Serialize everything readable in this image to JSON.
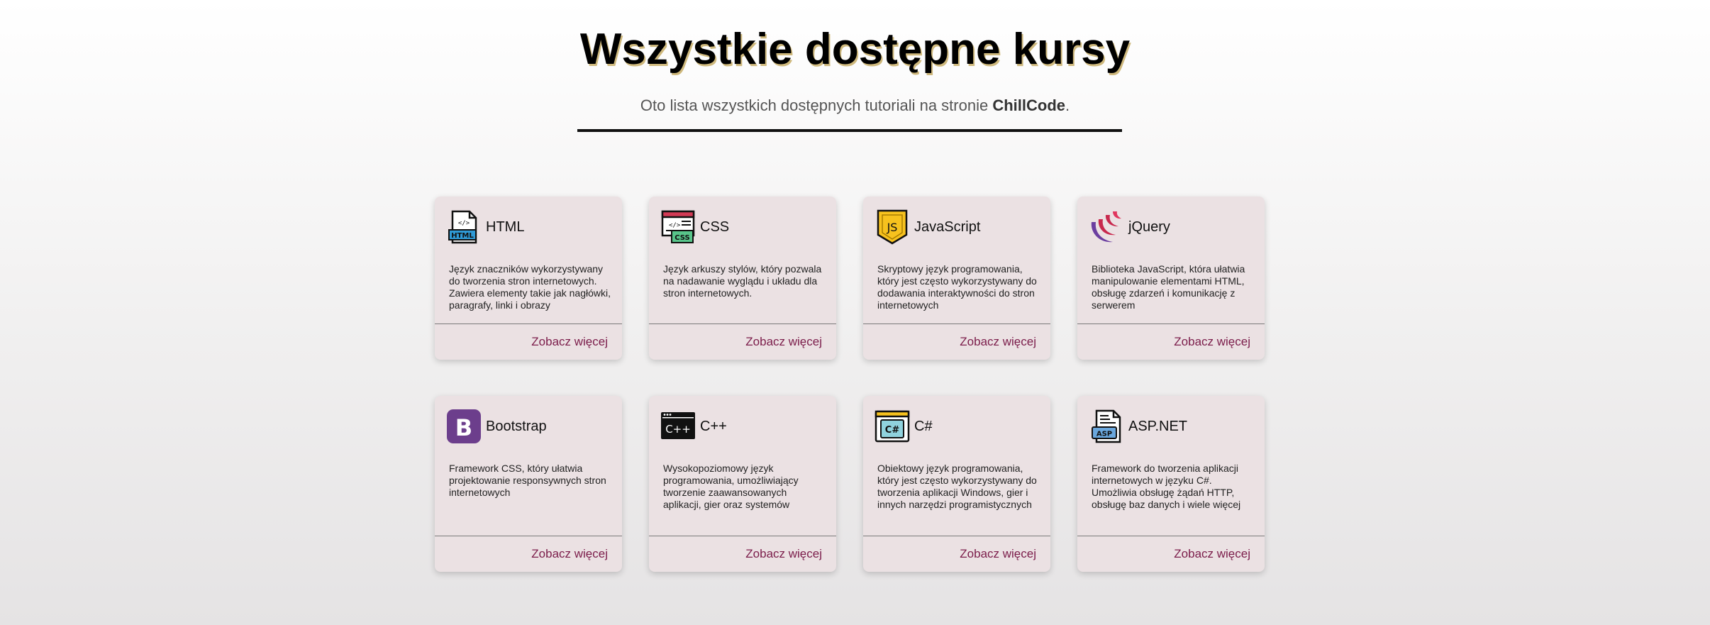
{
  "header": {
    "title": "Wszystkie dostępne kursy",
    "subtitle_prefix": "Oto lista wszystkich dostępnych tutoriali na stronie ",
    "subtitle_brand": "ChillCode",
    "subtitle_suffix": "."
  },
  "courses": [
    {
      "title": "HTML",
      "icon": "html-file-icon",
      "icon_text": "HTML",
      "description": "Język znaczników wykorzystywany do tworzenia stron internetowych. Zawiera elementy takie jak nagłówki, paragrafy, linki i obrazy",
      "link": "Zobacz więcej"
    },
    {
      "title": "CSS",
      "icon": "css-file-icon",
      "icon_text": "CSS",
      "description": "Język arkuszy stylów, który pozwala na nadawanie wyglądu i układu dla stron internetowych.",
      "link": "Zobacz więcej"
    },
    {
      "title": "JavaScript",
      "icon": "javascript-shield-icon",
      "icon_text": "JS",
      "description": "Skryptowy język programowania, który jest często wykorzystywany do dodawania interaktywności do stron internetowych",
      "link": "Zobacz więcej"
    },
    {
      "title": "jQuery",
      "icon": "jquery-logo-icon",
      "icon_text": "",
      "description": "Biblioteka JavaScript, która ułatwia manipulowanie elementami HTML, obsługę zdarzeń i komunikację z serwerem",
      "link": "Zobacz więcej"
    },
    {
      "title": "Bootstrap",
      "icon": "bootstrap-logo-icon",
      "icon_text": "B",
      "description": "Framework CSS, który ułatwia projektowanie responsywnych stron internetowych",
      "link": "Zobacz więcej"
    },
    {
      "title": "C++",
      "icon": "cpp-window-icon",
      "icon_text": "C++",
      "description": "Wysokopoziomowy język programowania, umożliwiający tworzenie zaawansowanych aplikacji, gier oraz systemów",
      "link": "Zobacz więcej"
    },
    {
      "title": "C#",
      "icon": "csharp-window-icon",
      "icon_text": "C#",
      "description": "Obiektowy język programowania, który jest często wykorzystywany do tworzenia aplikacji Windows, gier i innych narzędzi programistycznych",
      "link": "Zobacz więcej"
    },
    {
      "title": "ASP.NET",
      "icon": "aspnet-file-icon",
      "icon_text": "ASP",
      "description": "Framework do tworzenia aplikacji internetowych w języku C#. Umożliwia obsługę żądań HTTP, obsługę baz danych i wiele więcej",
      "link": "Zobacz więcej"
    }
  ],
  "colors": {
    "card_bg": "#ebe1e3",
    "link": "#7b1c4a",
    "js_yellow": "#f7c21e",
    "jquery_red": "#c8294e",
    "bootstrap_purple": "#6c3e8c",
    "html_blue": "#2f9ad6",
    "css_green": "#58c48a"
  }
}
